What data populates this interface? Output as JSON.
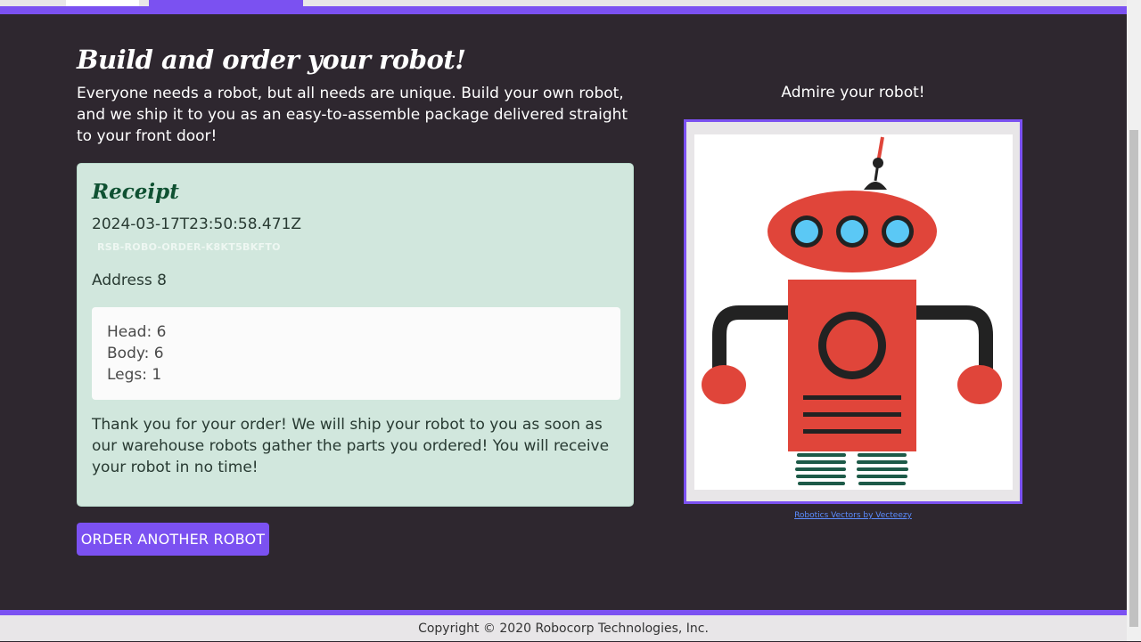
{
  "page": {
    "title": "Build and order your robot!",
    "intro": "Everyone needs a robot, but all needs are unique. Build your own robot, and we ship it to you as an easy-to-assemble package delivered straight to your front door!"
  },
  "receipt": {
    "heading": "Receipt",
    "timestamp": "2024-03-17T23:50:58.471Z",
    "order_id": "RSB-ROBO-ORDER-K8KT5BKFTO",
    "address": "Address 8",
    "parts": {
      "head": "Head: 6",
      "body": "Body: 6",
      "legs": "Legs: 1"
    },
    "thanks": "Thank you for your order! We will ship your robot to you as soon as our warehouse robots gather the parts you ordered! You will receive your robot in no time!"
  },
  "actions": {
    "order_another": "ORDER ANOTHER ROBOT"
  },
  "preview": {
    "caption": "Admire your robot!",
    "credit": "Robotics Vectors by Vecteezy"
  },
  "footer": {
    "copyright": "Copyright © 2020 Robocorp Technologies, Inc."
  },
  "colors": {
    "accent": "#7b51f1",
    "background": "#2e272f",
    "receipt_bg": "#d1e7dd",
    "robot_red": "#e0453a",
    "robot_eye": "#5bc8f5"
  }
}
